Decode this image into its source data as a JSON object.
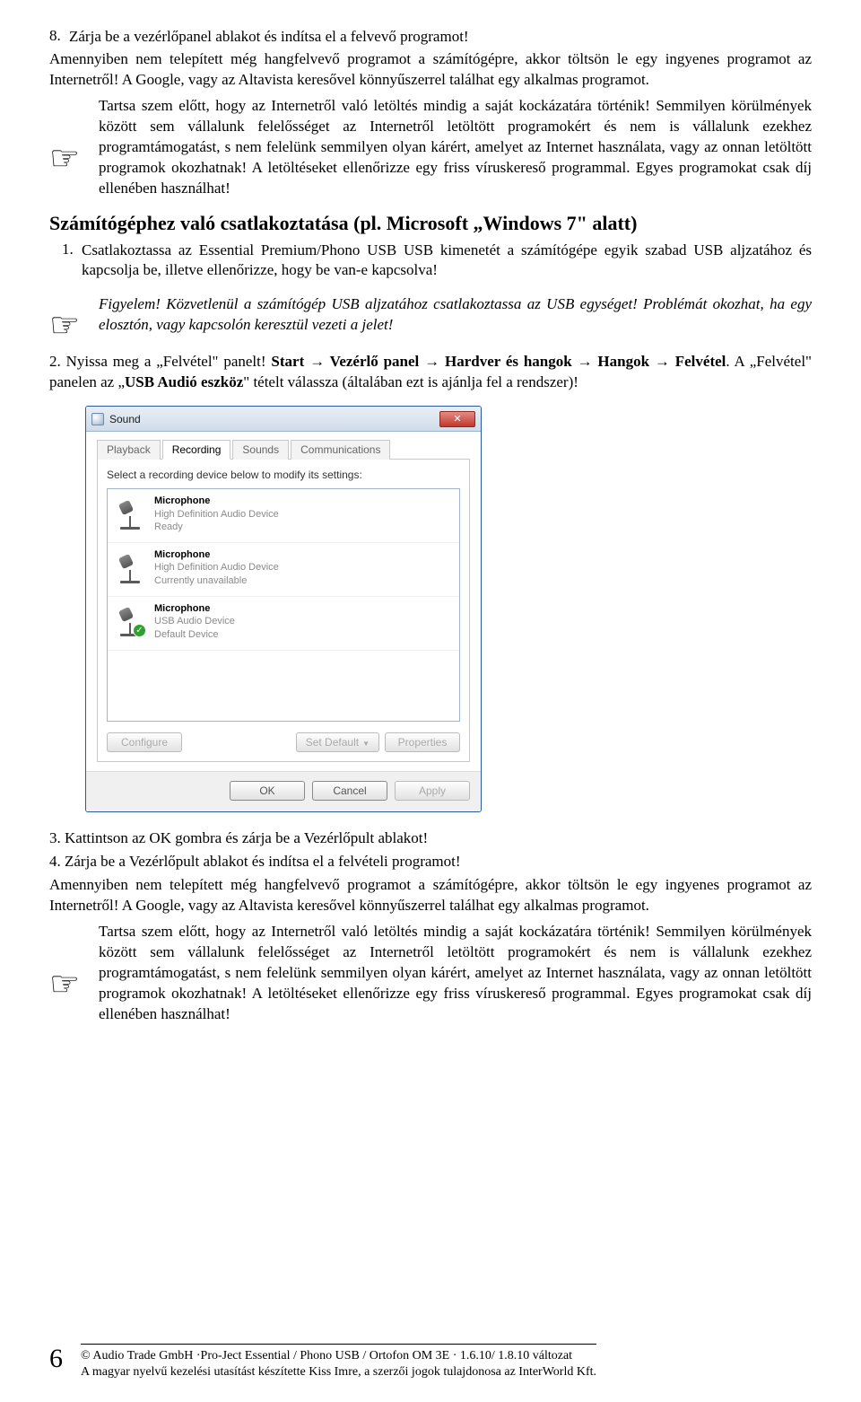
{
  "step8": {
    "num": "8.",
    "text": "Zárja be a vezérlőpanel ablakot és indítsa el a felvevő programot!"
  },
  "intro1": "Amennyiben nem telepített még hangfelvevő programot a számítógépre, akkor töltsön le egy ingyenes programot az Internetről! A Google, vagy az Altavista keresővel könnyűszerrel találhat egy alkalmas programot.",
  "note1": "Tartsa szem előtt, hogy az Internetről való letöltés mindig a saját kockázatára történik! Semmilyen körülmények között sem vállalunk felelősséget az Internetről letöltött programokért és nem is vállalunk ezekhez programtámogatást, s nem felelünk semmilyen olyan kárért, amelyet az Internet használata, vagy az onnan letöltött programok okozhatnak! A letöltéseket ellenőrizze egy friss víruskereső programmal. Egyes programokat csak díj ellenében használhat!",
  "heading": "Számítógéphez való csatlakoztatása (pl. Microsoft „Windows 7\" alatt)",
  "step1b": "Csatlakoztassa az Essential Premium/Phono USB USB kimenetét a számítógépe egyik szabad USB aljzatához és kapcsolja be, illetve ellenőrizze, hogy be van-e kapcsolva!",
  "warn1": "Figyelem! Közvetlenül a számítógép USB aljzatához csatlakoztassa az USB egységet! Problémát okozhat, ha egy elosztón, vagy kapcsolón keresztül vezeti a jelet!",
  "step2b_prefix": "2. Nyissa meg a „Felvétel\" panelt! ",
  "step2b_path": "Start → Vezérlő panel → Hardver és hangok → Hangok → Felvétel",
  "step2b_suffix": ". A „Felvétel\" panelen az „",
  "step2b_bold2": "USB Audió eszköz",
  "step2b_end": "\" tételt válassza (általában ezt is ajánlja fel a rendszer)!",
  "sound": {
    "title": "Sound",
    "tabs": [
      "Playback",
      "Recording",
      "Sounds",
      "Communications"
    ],
    "active_tab": 1,
    "desc": "Select a recording device below to modify its settings:",
    "devices": [
      {
        "name": "Microphone",
        "desc": "High Definition Audio Device",
        "status": "Ready",
        "default": false
      },
      {
        "name": "Microphone",
        "desc": "High Definition Audio Device",
        "status": "Currently unavailable",
        "default": false
      },
      {
        "name": "Microphone",
        "desc": "USB Audio Device",
        "status": "Default Device",
        "default": true
      }
    ],
    "btn_configure": "Configure",
    "btn_setdefault": "Set Default",
    "btn_properties": "Properties",
    "btn_ok": "OK",
    "btn_cancel": "Cancel",
    "btn_apply": "Apply"
  },
  "step3b": "3. Kattintson az OK gombra és zárja be a Vezérlőpult ablakot!",
  "step4b": "4. Zárja be a Vezérlőpult ablakot és indítsa el a felvételi programot!",
  "intro2": "Amennyiben nem telepített még hangfelvevő programot a számítógépre, akkor töltsön le egy ingyenes programot az Internetről! A Google, vagy az Altavista keresővel könnyűszerrel találhat egy alkalmas programot.",
  "note2": "Tartsa szem előtt, hogy az Internetről való letöltés mindig a saját kockázatára történik! Semmilyen körülmények között sem vállalunk felelősséget az Internetről letöltött programokért és nem is vállalunk ezekhez programtámogatást, s nem felelünk semmilyen olyan kárért, amelyet az Internet használata, vagy az onnan letöltött programok okozhatnak! A letöltéseket ellenőrizze egy friss víruskereső programmal. Egyes programokat csak díj ellenében használhat!",
  "footer": {
    "page": "6",
    "line1": "© Audio Trade GmbH ·Pro-Ject Essential / Phono USB / Ortofon OM 3E  · 1.6.10/ 1.8.10 változat",
    "line2": "A magyar nyelvű kezelési utasítást készítette Kiss Imre, a szerzői jogok tulajdonosa az InterWorld Kft."
  }
}
